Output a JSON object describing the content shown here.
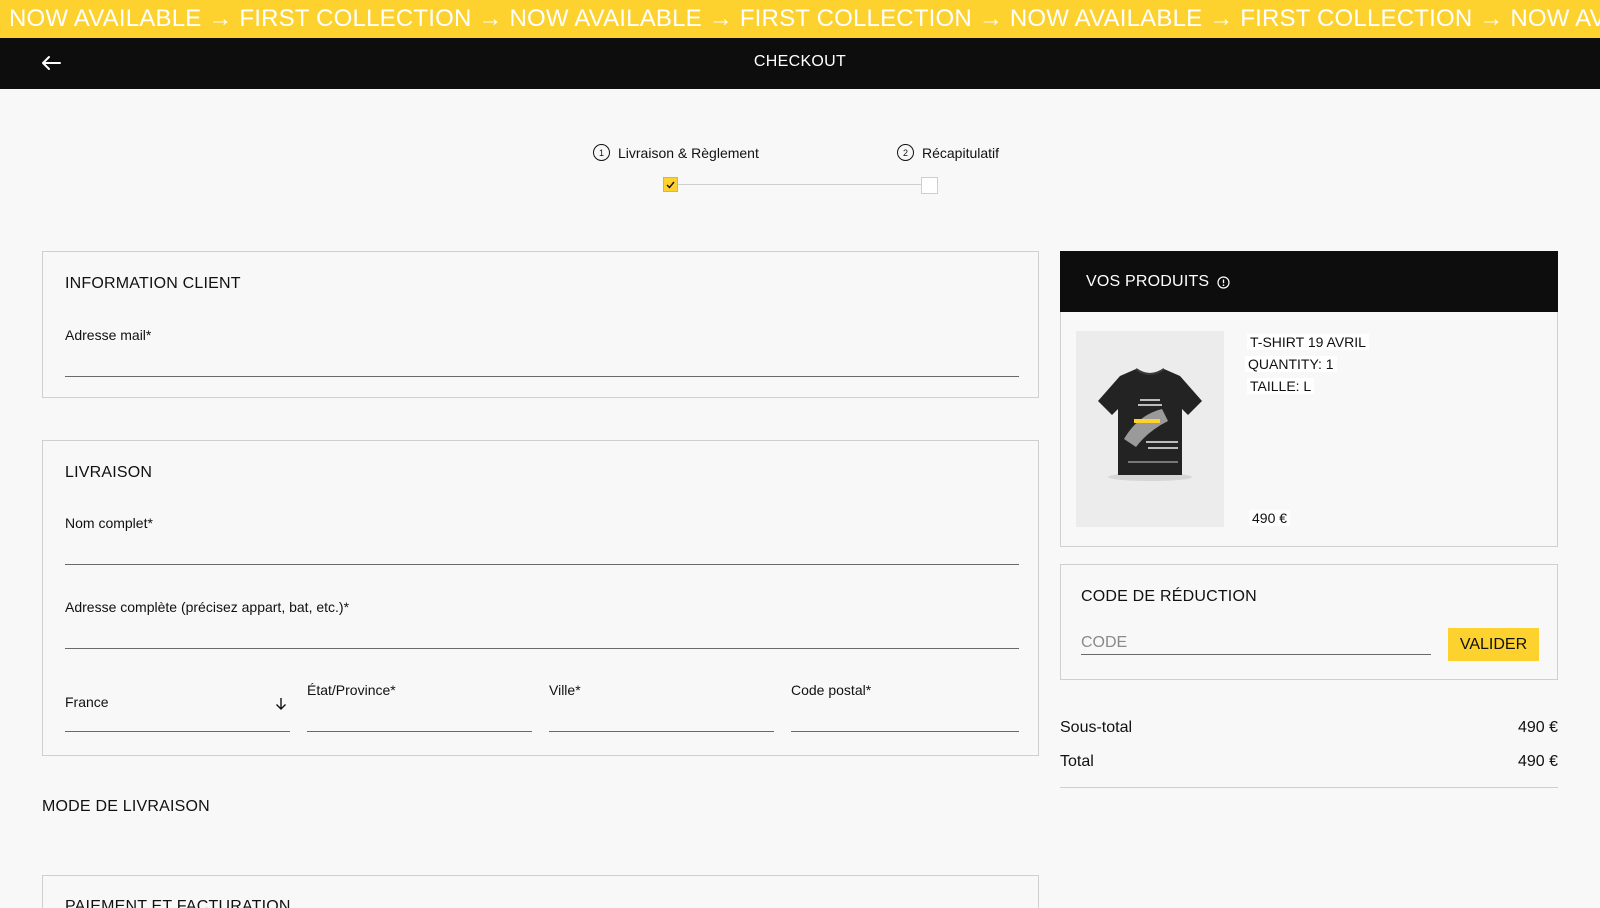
{
  "marquee": {
    "text": "NOW AVAILABLE → FIRST COLLECTION → NOW AVAILABLE → FIRST COLLECTION → NOW AVAILABLE → FIRST COLLECTION → NOW AVAILA"
  },
  "header": {
    "title": "CHECKOUT"
  },
  "steps": [
    {
      "number": "1",
      "label": "Livraison & Règlement"
    },
    {
      "number": "2",
      "label": "Récapitulatif"
    }
  ],
  "progress": {
    "current_step": 1,
    "total_steps": 2
  },
  "client_info": {
    "title": "INFORMATION CLIENT",
    "email_label": "Adresse mail*"
  },
  "delivery": {
    "title": "LIVRAISON",
    "name_label": "Nom complet*",
    "address_label": "Adresse complète (précisez appart, bat, etc.)*",
    "country_value": "France",
    "state_label": "État/Province*",
    "city_label": "Ville*",
    "zip_label": "Code postal*"
  },
  "shipping_mode": {
    "title": "MODE DE LIVRAISON"
  },
  "payment": {
    "title": "PAIEMENT ET FACTURATION"
  },
  "products": {
    "title": "VOS PRODUITS",
    "item": {
      "name": "T-SHIRT 19 AVRIL",
      "quantity": "QUANTITY:  1",
      "size": "TAILLE: L",
      "price": "490 €"
    }
  },
  "discount": {
    "title": "CODE DE RÉDUCTION",
    "placeholder": "CODE",
    "button": "VALIDER"
  },
  "summary": {
    "subtotal_label": "Sous-total",
    "subtotal_value": "490 €",
    "total_label": "Total",
    "total_value": "490 €"
  },
  "colors": {
    "accent": "#fdd22e",
    "dark": "#0d0d0d",
    "background": "#f8f8f8",
    "border": "#cfcfcf"
  }
}
